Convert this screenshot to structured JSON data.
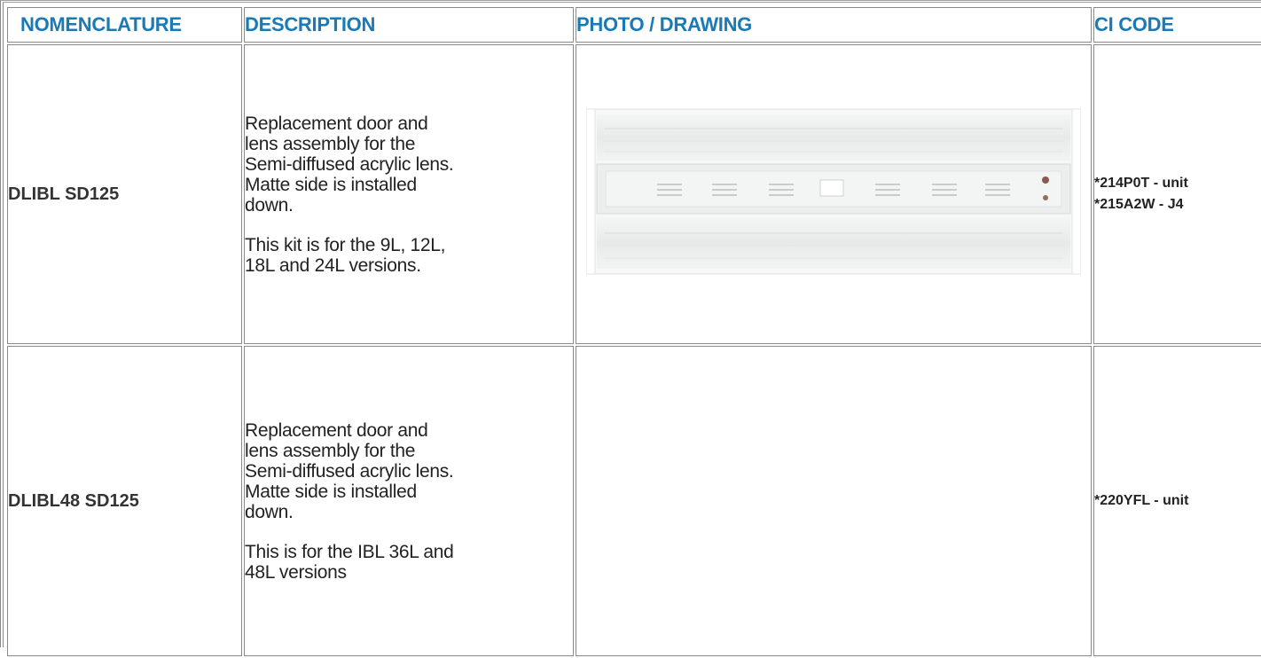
{
  "columns": {
    "nomenclature": "NOMENCLATURE",
    "description": "DESCRIPTION",
    "photo": "PHOTO / DRAWING",
    "ci_code": "CI CODE"
  },
  "rows": [
    {
      "nomenclature": "DLIBL SD125",
      "description_lines": [
        "Replacement door and",
        "lens assembly for the",
        "Semi-diffused acrylic lens.",
        "Matte side is installed",
        "down."
      ],
      "note_lines": [
        "This kit is for the 9L, 12L,",
        "18L and 24L versions."
      ],
      "has_photo": true,
      "photo_icon": "high-bay-light-fixture-photo",
      "codes": [
        "*214P0T - unit",
        "*215A2W - J4"
      ]
    },
    {
      "nomenclature": "DLIBL48 SD125",
      "description_lines": [
        "Replacement door and",
        "lens assembly for the",
        "Semi-diffused acrylic lens.",
        "Matte side is installed",
        "down."
      ],
      "note_lines": [
        "This is for the IBL 36L and",
        "48L versions"
      ],
      "has_photo": false,
      "codes": [
        "*220YFL - unit"
      ]
    }
  ],
  "colors": {
    "header_text": "#1a7ab5",
    "border": "#8a8a8a",
    "body_text": "#222222"
  }
}
